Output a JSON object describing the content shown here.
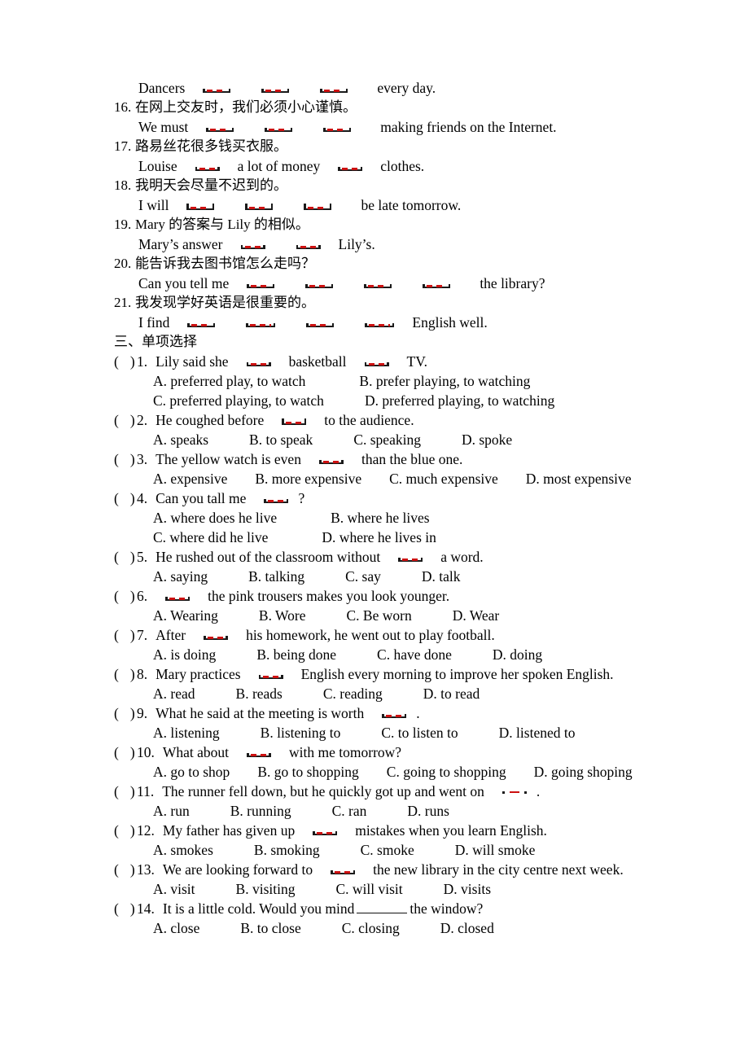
{
  "document": {
    "type": "english-exam-worksheet",
    "language_mix": [
      "zh-CN",
      "en"
    ],
    "colors": {
      "text": "#000000",
      "blank_rule": "#1a1a1a",
      "blank_dash": "#cc1111",
      "background": "#ffffff"
    }
  },
  "translation_section": {
    "carryover_line": {
      "lead": "Dancers",
      "tail": "every day.",
      "blanks": 3
    },
    "items": [
      {
        "number": "16.",
        "chinese": "在网上交友时，我们必须小心谨慎。",
        "lead": "We must",
        "tail": "making friends on the Internet.",
        "blanks": 3
      },
      {
        "number": "17.",
        "chinese": "路易丝花很多钱买衣服。",
        "lead": "Louise",
        "middle": "a lot of money",
        "tail": "clothes.",
        "blanks": 2
      },
      {
        "number": "18.",
        "chinese": "我明天会尽量不迟到的。",
        "lead": "I will",
        "tail": "be late tomorrow.",
        "blanks": 3
      },
      {
        "number": "19.",
        "chinese": "Mary 的答案与 Lily 的相似。",
        "lead": "Mary’s answer",
        "tail": "Lily’s.",
        "blanks": 2
      },
      {
        "number": "20.",
        "chinese": "能告诉我去图书馆怎么走吗？",
        "lead": "Can you tell me",
        "tail": "the library?",
        "blanks": 4
      },
      {
        "number": "21.",
        "chinese": "我发现学好英语是很重要的。",
        "lead": "I find",
        "tail": "English well.",
        "blanks": 4
      }
    ]
  },
  "choice_section": {
    "heading": "三、单项选择",
    "bracket_left": "(",
    "bracket_right": ")",
    "questions": [
      {
        "number": "1.",
        "stem_lead": "Lily said she",
        "stem_mid": "basketball",
        "stem_tail": "TV.",
        "blanks": 2,
        "layout": "two-per-row",
        "options": [
          "A. preferred play, to watch",
          "B. prefer playing, to watching",
          "C. preferred playing, to watch",
          "D. preferred playing, to watching"
        ]
      },
      {
        "number": "2.",
        "stem_lead": "He coughed before",
        "stem_tail": "to the audience.",
        "blanks": 1,
        "layout": "four-per-row",
        "options": [
          "A. speaks",
          "B. to speak",
          "C. speaking",
          "D. spoke"
        ]
      },
      {
        "number": "3.",
        "stem_lead": "The yellow watch is even",
        "stem_tail": "than the blue one.",
        "blanks": 1,
        "layout": "four-per-row",
        "options": [
          "A. expensive",
          "B. more expensive",
          "C. much expensive",
          "D. most expensive"
        ]
      },
      {
        "number": "4.",
        "stem_lead": "Can you tall me",
        "stem_tail": "?",
        "blanks": 1,
        "layout": "two-per-row",
        "options": [
          "A. where does he live",
          "B. where he lives",
          "C. where did he live",
          "D. where he lives in"
        ]
      },
      {
        "number": "5.",
        "stem_lead": "He rushed out of the classroom without",
        "stem_tail": "a word.",
        "blanks": 1,
        "layout": "four-per-row",
        "options": [
          "A. saying",
          "B. talking",
          "C. say",
          "D. talk"
        ]
      },
      {
        "number": "6.",
        "stem_lead": "",
        "stem_tail": "the pink trousers makes you look younger.",
        "blanks": 1,
        "layout": "four-per-row",
        "options": [
          "A. Wearing",
          "B. Wore",
          "C. Be worn",
          "D. Wear"
        ]
      },
      {
        "number": "7.",
        "stem_lead": "After",
        "stem_tail": "his homework, he went out to play football.",
        "blanks": 1,
        "layout": "four-per-row",
        "options": [
          "A. is doing",
          "B. being done",
          "C. have done",
          "D. doing"
        ]
      },
      {
        "number": "8.",
        "stem_lead": "Mary practices",
        "stem_tail": "English every morning to improve her spoken English.",
        "blanks": 1,
        "layout": "four-per-row",
        "options": [
          "A. read",
          "B. reads",
          "C. reading",
          "D. to read"
        ]
      },
      {
        "number": "9.",
        "stem_lead": "What he said at the meeting is worth",
        "stem_tail": ".",
        "blanks": 1,
        "layout": "four-per-row",
        "options": [
          "A. listening",
          "B. listening to",
          "C. to listen to",
          "D. listened to"
        ]
      },
      {
        "number": "10.",
        "stem_lead": "What about",
        "stem_tail": "with me tomorrow?",
        "blanks": 1,
        "layout": "four-per-row",
        "options": [
          "A. go to shop",
          "B. go to shopping",
          "C. going to shopping",
          "D. going shoping"
        ]
      },
      {
        "number": "11.",
        "stem_lead": "The runner fell down, but he quickly got up and went on",
        "stem_tail": ".",
        "blanks": 1,
        "blank_style": "sparse",
        "layout": "four-per-row",
        "options": [
          "A. run",
          "B. running",
          "C. ran",
          "D. runs"
        ]
      },
      {
        "number": "12.",
        "stem_lead": "My father has given up",
        "stem_tail": "mistakes when you learn English.",
        "blanks": 1,
        "layout": "four-per-row",
        "options": [
          "A. smokes",
          "B. smoking",
          "C. smoke",
          "D. will smoke"
        ]
      },
      {
        "number": "13.",
        "stem_lead": "We are looking forward to",
        "stem_tail": "the new library in the city centre next week.",
        "blanks": 1,
        "layout": "four-per-row",
        "options": [
          "A. visit",
          "B. visiting",
          "C. will visit",
          "D. visits"
        ]
      },
      {
        "number": "14.",
        "stem_lead": "It is a little cold. Would you mind",
        "stem_tail": "the window?",
        "blanks": 1,
        "blank_style": "solid",
        "layout": "four-per-row",
        "options": [
          "A. close",
          "B. to close",
          "C. closing",
          "D. closed"
        ]
      }
    ]
  }
}
